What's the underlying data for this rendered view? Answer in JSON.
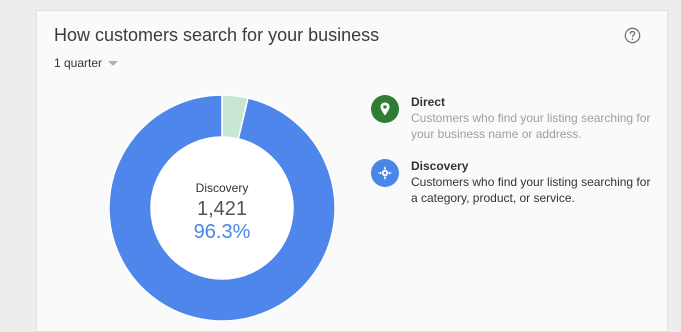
{
  "card": {
    "title": "How customers search for your business",
    "period_label": "1 quarter"
  },
  "icons": {
    "help": "help-circle-icon",
    "direct": "map-pin-icon",
    "discovery": "compass-icon",
    "period_dropdown": "caret-down-icon"
  },
  "center": {
    "label": "Discovery",
    "count": "1,421",
    "percent": "96.3%"
  },
  "legend": [
    {
      "name": "Direct",
      "description": "Customers who find your listing searching for your business name or address.",
      "color": "#2e7d32",
      "text_color": "#9e9e9e"
    },
    {
      "name": "Discovery",
      "description": "Customers who find your listing searching for a category, product, or service.",
      "color": "#4a86e8",
      "text_color": "#333333"
    }
  ],
  "chart_data": {
    "type": "pie",
    "donut": true,
    "categories": [
      "Direct",
      "Discovery"
    ],
    "values": [
      3.7,
      96.3
    ],
    "colors": [
      "#c8e6d4",
      "#4f86ec"
    ],
    "highlighted": "Discovery"
  }
}
